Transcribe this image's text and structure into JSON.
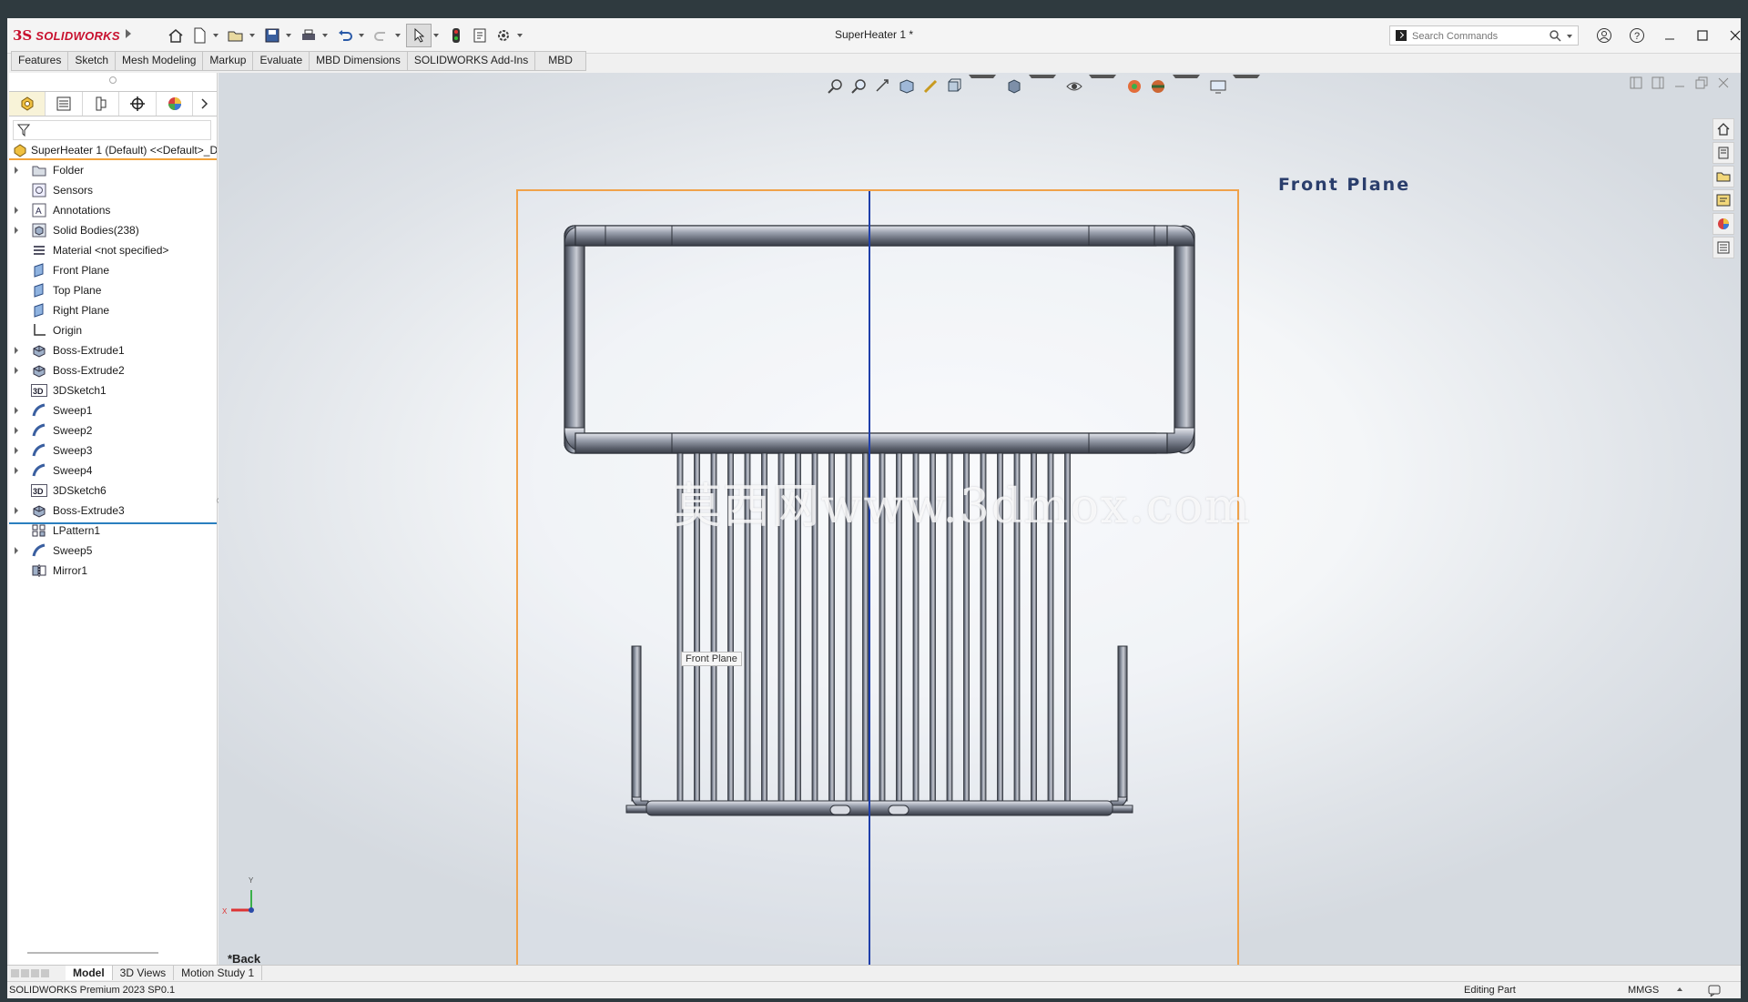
{
  "app": {
    "title": "SuperHeater 1 *",
    "logo_ds": "3S",
    "logo_text": "SOLIDWORKS"
  },
  "search": {
    "placeholder": "Search Commands"
  },
  "ribbon": {
    "tabs": [
      "Features",
      "Sketch",
      "Mesh Modeling",
      "Markup",
      "Evaluate",
      "MBD Dimensions",
      "SOLIDWORKS Add-Ins",
      "MBD"
    ]
  },
  "tree": {
    "root": "SuperHeater 1 (Default) <<Default>_D",
    "items": [
      {
        "label": "Folder",
        "icon": "folder-icon"
      },
      {
        "label": "Sensors",
        "icon": "sensor-icon"
      },
      {
        "label": "Annotations",
        "icon": "annotation-icon"
      },
      {
        "label": "Solid Bodies(238)",
        "icon": "solid-bodies-icon"
      },
      {
        "label": "Material <not specified>",
        "icon": "material-icon"
      },
      {
        "label": "Front Plane",
        "icon": "plane-icon"
      },
      {
        "label": "Top Plane",
        "icon": "plane-icon"
      },
      {
        "label": "Right Plane",
        "icon": "plane-icon"
      },
      {
        "label": "Origin",
        "icon": "origin-icon"
      },
      {
        "label": "Boss-Extrude1",
        "icon": "extrude-icon"
      },
      {
        "label": "Boss-Extrude2",
        "icon": "extrude-icon"
      },
      {
        "label": "3DSketch1",
        "icon": "3dsketch-icon",
        "badge": "3D"
      },
      {
        "label": "Sweep1",
        "icon": "sweep-icon"
      },
      {
        "label": "Sweep2",
        "icon": "sweep-icon"
      },
      {
        "label": "Sweep3",
        "icon": "sweep-icon"
      },
      {
        "label": "Sweep4",
        "icon": "sweep-icon"
      },
      {
        "label": "3DSketch6",
        "icon": "3dsketch-icon",
        "badge": "3D"
      },
      {
        "label": "Boss-Extrude3",
        "icon": "extrude-icon"
      },
      {
        "label": "LPattern1",
        "icon": "pattern-icon"
      },
      {
        "label": "Sweep5",
        "icon": "sweep-icon"
      },
      {
        "label": "Mirror1",
        "icon": "mirror-icon"
      }
    ]
  },
  "viewport": {
    "plane_label": "Front Plane",
    "plane_tag": "Front Plane",
    "view_name": "*Back",
    "watermark": "莫西网www.3dmox.com",
    "triad": {
      "x": "X",
      "y": "Y"
    }
  },
  "bottom_tabs": [
    "Model",
    "3D Views",
    "Motion Study 1"
  ],
  "status": {
    "left": "SOLIDWORKS Premium 2023 SP0.1",
    "mode": "Editing Part",
    "units": "MMGS"
  },
  "colors": {
    "accent_orange": "#f2a23a",
    "brand_red": "#c8102e",
    "selection_blue": "#2a7fbf"
  }
}
